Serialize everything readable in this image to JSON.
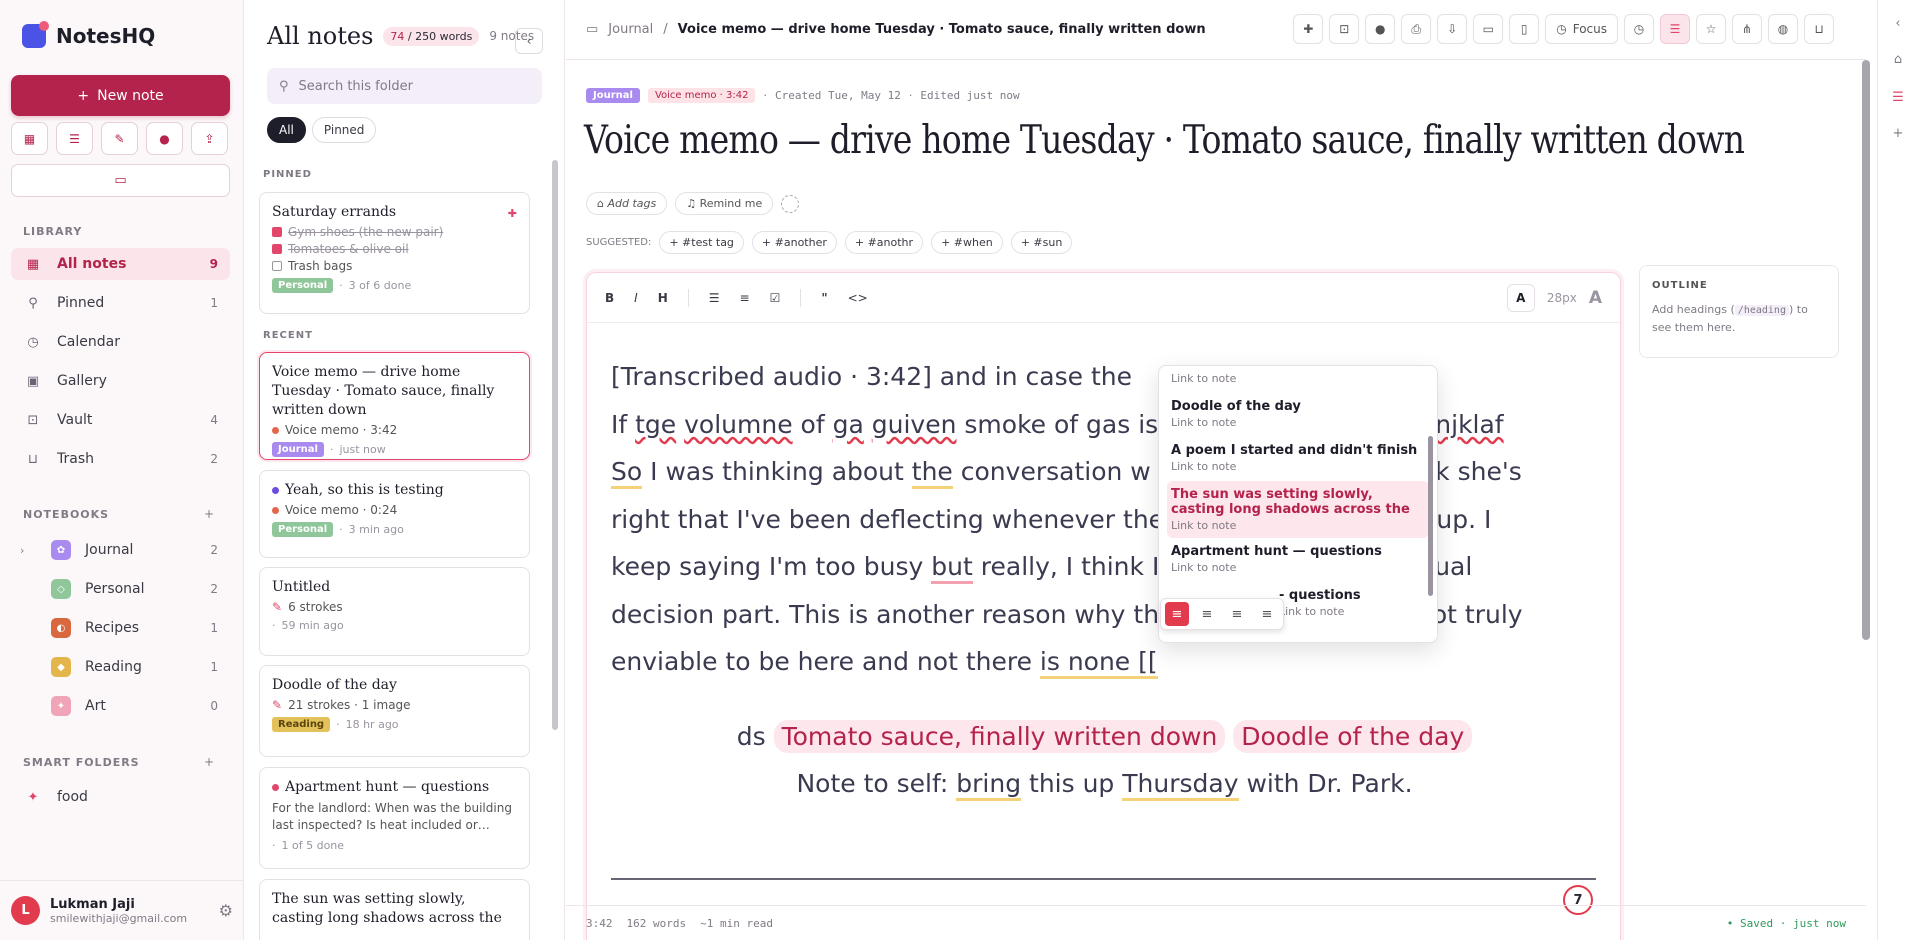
{
  "app": {
    "name": "NotesHQ"
  },
  "sidebar": {
    "new_note": "New note",
    "library_label": "LIBRARY",
    "library": [
      {
        "label": "All notes",
        "count": "9",
        "icon": "grid-icon"
      },
      {
        "label": "Pinned",
        "count": "1",
        "icon": "pin-icon"
      },
      {
        "label": "Calendar",
        "count": "",
        "icon": "clock-icon"
      },
      {
        "label": "Gallery",
        "count": "",
        "icon": "image-icon"
      },
      {
        "label": "Vault",
        "count": "4",
        "icon": "lock-icon"
      },
      {
        "label": "Trash",
        "count": "2",
        "icon": "trash-icon"
      }
    ],
    "notebooks_label": "NOTEBOOKS",
    "notebooks": [
      {
        "label": "Journal",
        "count": "2",
        "color": "#a98bf0"
      },
      {
        "label": "Personal",
        "count": "2",
        "color": "#8fc79a"
      },
      {
        "label": "Recipes",
        "count": "1",
        "color": "#d9683f"
      },
      {
        "label": "Reading",
        "count": "1",
        "color": "#e3b54a"
      },
      {
        "label": "Art",
        "count": "0",
        "color": "#f0a4b8"
      }
    ],
    "smart_label": "SMART FOLDERS",
    "smart": [
      {
        "label": "food"
      }
    ],
    "user": {
      "initial": "L",
      "name": "Lukman Jaji",
      "email": "smilewithjaji@gmail.com"
    }
  },
  "list": {
    "title": "All notes",
    "words": "74",
    "words_total": "/ 250 words",
    "note_count": "9 notes",
    "search_placeholder": "Search this folder",
    "filter_all": "All",
    "filter_pinned": "Pinned",
    "pinned_label": "PINNED",
    "recent_label": "RECENT",
    "cards": {
      "errands": {
        "title": "Saturday errands",
        "i1": "Gym shoes (the new pair)",
        "i2": "Tomatoes & olive oil",
        "i3": "Trash bags",
        "tag": "Personal",
        "meta": "3 of 6 done"
      },
      "memo": {
        "title": "Voice memo — drive home Tuesday · Tomato sauce, finally written down",
        "line": "Voice memo · 3:42",
        "tag": "Journal",
        "meta": "just now"
      },
      "testing": {
        "title": "Yeah, so this is testing",
        "line": "Voice memo · 0:24",
        "tag": "Personal",
        "meta": "3 min ago"
      },
      "untitled": {
        "title": "Untitled",
        "line": "6 strokes",
        "meta": "59 min ago"
      },
      "doodle": {
        "title": "Doodle of the day",
        "line": "21 strokes · 1 image",
        "tag": "Reading",
        "meta": "18 hr ago"
      },
      "apartment": {
        "title": "Apartment hunt — questions",
        "line": "For the landlord: When was the building last inspected? Is heat included or…",
        "meta": "1 of 5 done"
      },
      "sun": {
        "title": "The sun was setting slowly, casting long shadows across the"
      }
    }
  },
  "main": {
    "crumb_root": "Journal",
    "crumb_current": "Voice memo — drive home Tuesday · Tomato sauce, finally written down",
    "focus_label": "Focus",
    "badge_journal": "Journal",
    "badge_memo": "Voice memo · 3:42",
    "created": "Created Tue, May 12",
    "edited": "Edited just now",
    "title": "Voice memo — drive home Tuesday · Tomato sauce, finally written down",
    "add_tags": "Add tags",
    "remind": "Remind me",
    "suggested_label": "SUGGESTED:",
    "suggested": [
      "+ #test tag",
      "+ #another",
      "+ #anothr",
      "+ #when",
      "+ #sun"
    ],
    "font_size": "28px",
    "text": {
      "l1": "[Transcribed audio · 3:42] and in case the",
      "l2a": "If ",
      "l2b": "tge",
      "l2c": " ",
      "l2d": "volumne",
      "l2e": " of ",
      "l2f": "ga",
      "l2g": " ",
      "l2h": "guiven",
      "l2i": " smoke of gas is",
      "l2j": "f ",
      "l2k": "mnjklaf",
      "l3a": "So",
      "l3b": " I was thinking about ",
      "l3c": "the",
      "l3d": " conversation w",
      "l3e": "think she's",
      "l4a": "right that I've been deflecting whenever the",
      "l4b": "es up. I",
      "l5a": "keep saying I'm too busy ",
      "l5b": "but",
      "l5c": " really, I think I",
      "l5d": "actual",
      "l6a": "decision part. This is another reason why th",
      "l6b": "s not truly",
      "l7a": "enviable to be here and not there ",
      "l7b": "is none [[",
      "ds": "ds",
      "link1": "Tomato sauce, finally written down",
      "link2": "Doodle of the day",
      "note_a": "Note to self: ",
      "note_b": "bring",
      "note_c": " this up ",
      "note_d": "Thursday",
      "note_e": " with Dr. Park."
    },
    "counter": "7",
    "dropdown": {
      "top_sub": "Link to note",
      "items": [
        {
          "title": "Doodle of the day",
          "sub": "Link to note"
        },
        {
          "title": "A poem I started and didn't finish",
          "sub": "Link to note"
        },
        {
          "title": "The sun was setting slowly, casting long shadows across the",
          "sub": "Link to note"
        },
        {
          "title": "Apartment hunt — questions",
          "sub": "Link to note"
        },
        {
          "title": "- questions",
          "sub": "Link to note"
        }
      ]
    },
    "outline": {
      "title": "OUTLINE",
      "text_a": "Add headings (",
      "code": "/heading",
      "text_b": ") to see them here."
    },
    "status": {
      "duration": "3:42",
      "words": "162 words",
      "read": "~1 min read",
      "saved": "• Saved · just now"
    }
  }
}
